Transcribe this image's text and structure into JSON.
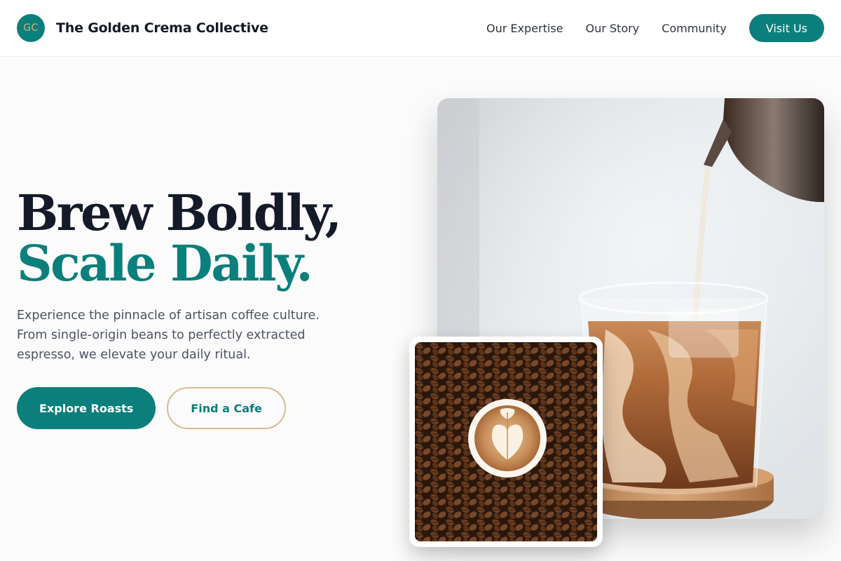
{
  "header": {
    "logo_initials": "GC",
    "brand_name": "The Golden Crema Collective",
    "nav": [
      {
        "label": "Our Expertise"
      },
      {
        "label": "Our Story"
      },
      {
        "label": "Community"
      }
    ],
    "visit_label": "Visit Us"
  },
  "hero": {
    "title_line1": "Brew Boldly,",
    "title_line2": "Scale Daily.",
    "subtitle": "Experience the pinnacle of artisan coffee culture. From single-origin beans to perfectly extracted espresso, we elevate your daily ritual.",
    "primary_cta": "Explore Roasts",
    "secondary_cta": "Find a Cafe"
  },
  "images": {
    "main_photo": "iced-latte-photo",
    "inset_photo": "latte-art-on-beans-photo"
  },
  "colors": {
    "brand_teal": "#0b7f7b",
    "accent_gold": "#dcb98e",
    "heading_dark": "#141a27"
  }
}
